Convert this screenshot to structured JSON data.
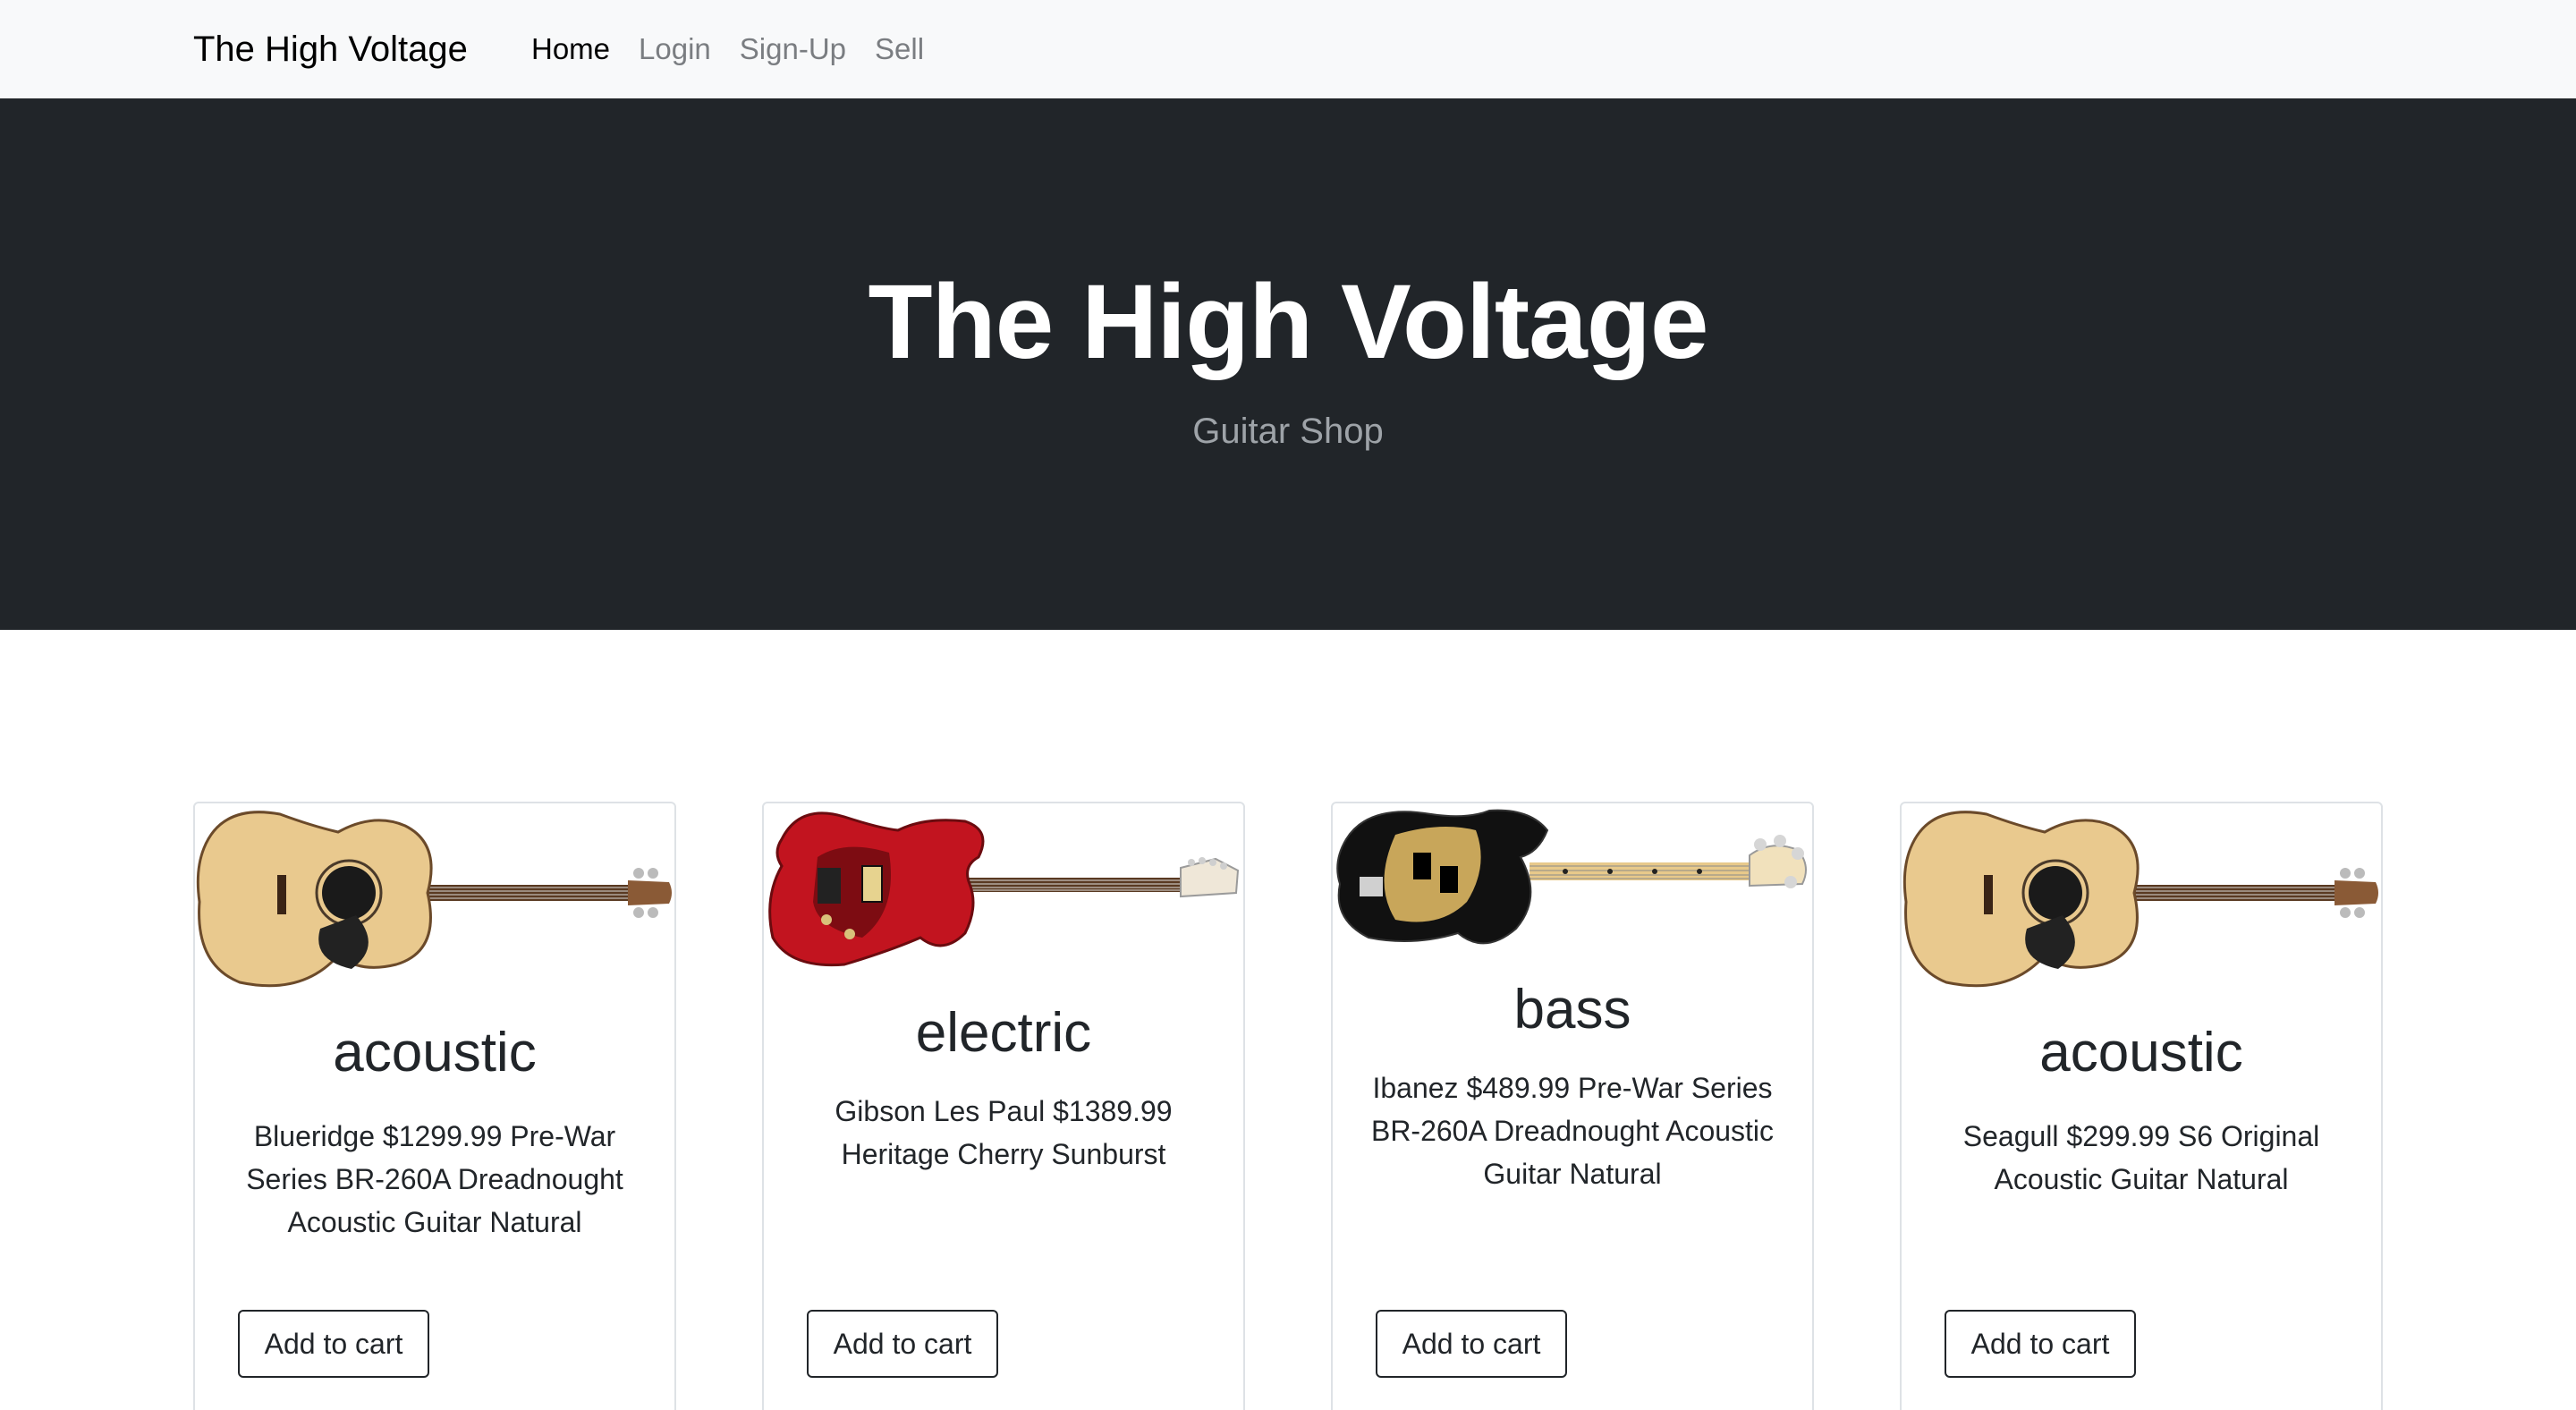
{
  "navbar": {
    "brand": "The High Voltage",
    "links": [
      {
        "label": "Home",
        "active": true
      },
      {
        "label": "Login",
        "active": false
      },
      {
        "label": "Sign-Up",
        "active": false
      },
      {
        "label": "Sell",
        "active": false
      }
    ]
  },
  "hero": {
    "title": "The High Voltage",
    "subtitle": "Guitar Shop"
  },
  "products": [
    {
      "category": "acoustic",
      "description": "Blueridge $1299.99 Pre-War Series BR-260A Dreadnought Acoustic Guitar Natural",
      "image": "acoustic-guitar-image",
      "button": "Add to cart"
    },
    {
      "category": "electric",
      "description": "Gibson Les Paul $1389.99 Heritage Cherry Sunburst",
      "image": "electric-guitar-image",
      "button": "Add to cart"
    },
    {
      "category": "bass",
      "description": "Ibanez $489.99 Pre-War Series BR-260A Dreadnought Acoustic Guitar Natural",
      "image": "bass-guitar-image",
      "button": "Add to cart"
    },
    {
      "category": "acoustic",
      "description": "Seagull $299.99 S6 Original Acoustic Guitar Natural",
      "image": "acoustic-guitar-image",
      "button": "Add to cart"
    }
  ],
  "colors": {
    "navbar_bg": "#f8f9fa",
    "hero_bg": "#212529",
    "hero_title": "#ffffff",
    "hero_subtitle": "#9ea3a8",
    "text": "#212529",
    "nav_inactive": "#7a7d81",
    "card_border": "#dee2e6"
  }
}
